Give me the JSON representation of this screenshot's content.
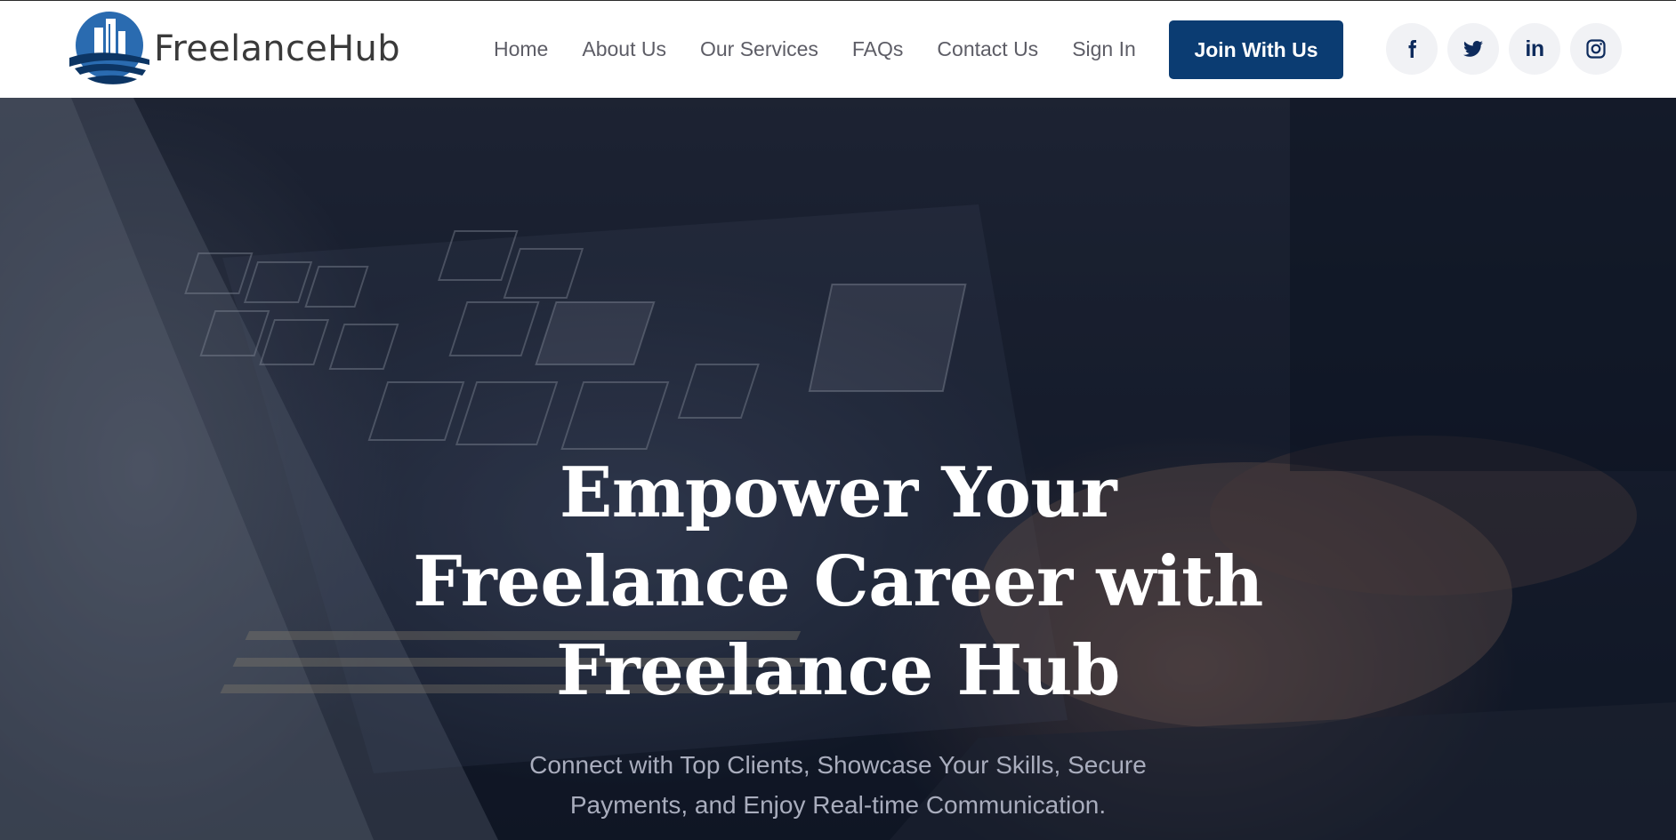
{
  "brand": {
    "name": "FreelanceHub",
    "colors": {
      "primary": "#0b3c72",
      "logo_blue": "#2a6bb0",
      "nav_text": "#5d5d66"
    }
  },
  "nav": {
    "items": [
      {
        "label": "Home"
      },
      {
        "label": "About Us"
      },
      {
        "label": "Our Services"
      },
      {
        "label": "FAQs"
      },
      {
        "label": "Contact Us"
      },
      {
        "label": "Sign In"
      }
    ],
    "cta_label": "Join With Us"
  },
  "socials": [
    {
      "name": "facebook-icon"
    },
    {
      "name": "twitter-icon"
    },
    {
      "name": "linkedin-icon",
      "text": "in"
    },
    {
      "name": "instagram-icon"
    }
  ],
  "hero": {
    "title_lines": [
      "Empower Your",
      "Freelance Career with",
      "Freelance Hub"
    ],
    "subtitle_lines": [
      "Connect with Top Clients, Showcase Your Skills, Secure",
      "Payments, and Enjoy Real-time Communication."
    ]
  }
}
